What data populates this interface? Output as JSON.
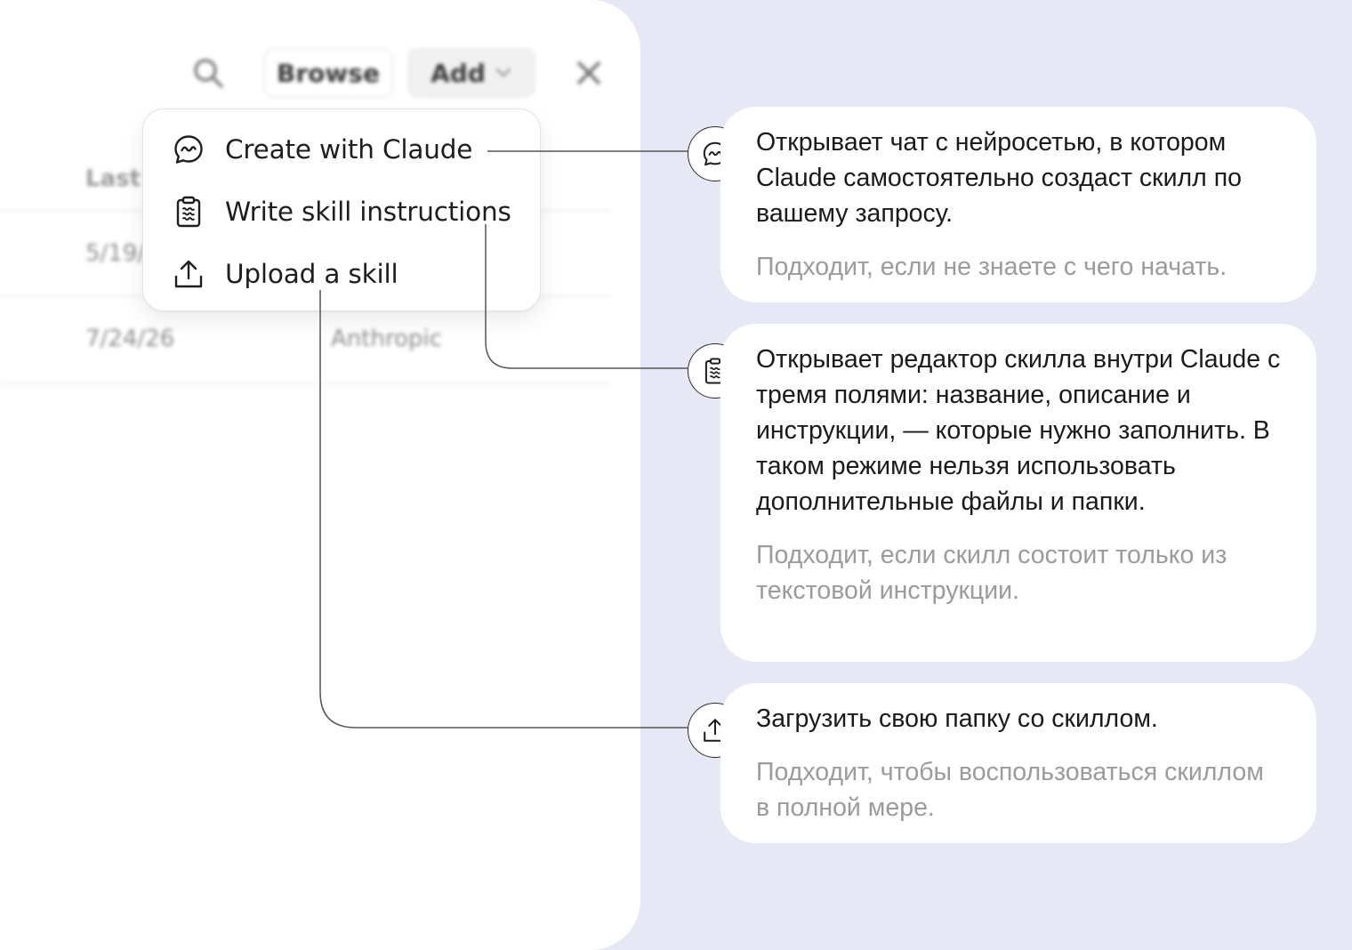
{
  "toolbar": {
    "search_icon": "search-icon",
    "browse_label": "Browse",
    "add_label": "Add",
    "add_chevron_icon": "chevron-down-icon",
    "close_icon": "close-icon"
  },
  "table": {
    "column_header": "Last",
    "rows": [
      {
        "date": "5/19/",
        "author": ""
      },
      {
        "date": "7/24/26",
        "author": "Anthropic"
      }
    ]
  },
  "menu": {
    "items": [
      {
        "icon": "chat-bubble-icon",
        "label": "Create with Claude"
      },
      {
        "icon": "clipboard-icon",
        "label": "Write skill instructions"
      },
      {
        "icon": "upload-icon",
        "label": "Upload a skill"
      }
    ]
  },
  "callouts": [
    {
      "icon": "chat-bubble-icon",
      "description": "Открывает чат с нейросетью, в котором Claude самостоятельно создаст скилл по вашему запросу.",
      "hint": "Подходит, если не знаете с чего начать."
    },
    {
      "icon": "clipboard-icon",
      "description": "Открывает редактор скилла внутри Claude с тремя полями: название, описание и инструкции, — которые нужно заполнить. В таком режиме нельзя использовать дополнительные файлы и папки.",
      "hint": "Подходит, если скилл состоит только из текстовой инструкции."
    },
    {
      "icon": "upload-icon",
      "description": "Загрузить свою папку со скиллом.",
      "hint": "Подходит, чтобы воспользоваться скиллом в полной мере."
    }
  ],
  "colors": {
    "page_background": "#e7e8f5",
    "panel_background": "#ffffff",
    "description_text": "#1a1a1a",
    "hint_text": "#9b9b9b",
    "connector_line": "#555555"
  }
}
